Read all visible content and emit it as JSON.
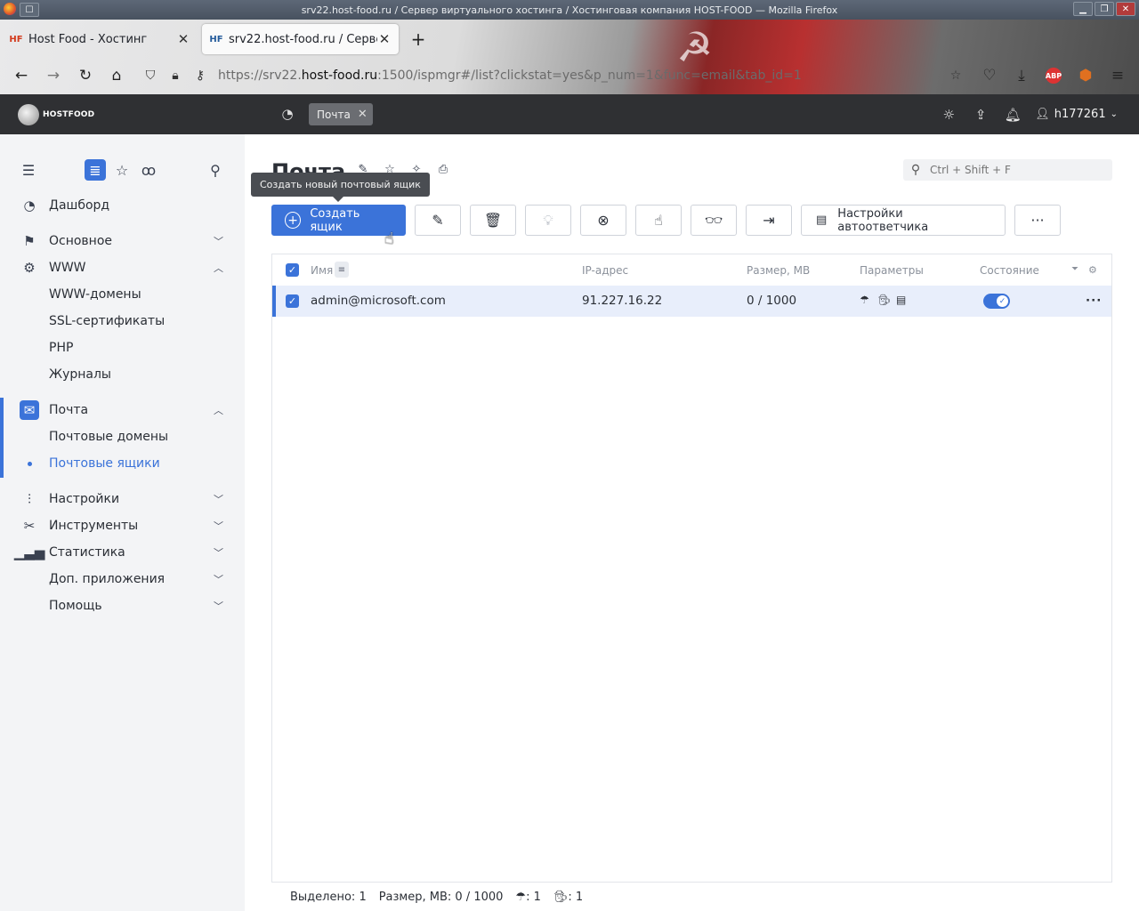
{
  "window": {
    "title": "srv22.host-food.ru / Сервер виртуального хостинга / Хостинговая компания HOST-FOOD — Mozilla Firefox"
  },
  "browser": {
    "tabs": [
      {
        "label": "Host Food - Хостинг",
        "favicon": "HF"
      },
      {
        "label": "srv22.host-food.ru / Сервер",
        "favicon": "HF"
      }
    ],
    "url_prefix": "https://srv22.",
    "url_host": "host-food.ru",
    "url_rest": ":1500/ispmgr#/list?clickstat=yes&p_num=1&func=email&tab_id=1",
    "extensions": [
      "pocket-icon",
      "download-icon",
      "adblock-icon",
      "shield-icon",
      "menu-icon"
    ],
    "abp_label": "ABP"
  },
  "app": {
    "logo_text": "HOSTFOOD",
    "active_chip": "Почта",
    "user": "h177261"
  },
  "sidebar": {
    "items": [
      {
        "label": "Дашборд",
        "icon": "dashboard-icon"
      },
      {
        "label": "Основное",
        "icon": "flag-icon"
      },
      {
        "label": "WWW",
        "icon": "www-icon"
      },
      {
        "label": "WWW-домены"
      },
      {
        "label": "SSL-сертификаты"
      },
      {
        "label": "PHP"
      },
      {
        "label": "Журналы"
      },
      {
        "label": "Почта",
        "icon": "mail-icon"
      },
      {
        "label": "Почтовые домены"
      },
      {
        "label": "Почтовые ящики"
      },
      {
        "label": "Настройки",
        "icon": "sliders-icon"
      },
      {
        "label": "Инструменты",
        "icon": "tools-icon"
      },
      {
        "label": "Статистика",
        "icon": "stats-icon"
      },
      {
        "label": "Доп. приложения"
      },
      {
        "label": "Помощь"
      }
    ]
  },
  "main": {
    "title": "Почта",
    "tooltip": "Создать новый почтовый ящик",
    "search_placeholder": "Ctrl + Shift + F",
    "create_label": "Создать ящик",
    "autoresponder_label": "Настройки автоответчика",
    "columns": [
      "Имя",
      "IP-адрес",
      "Размер, MB",
      "Параметры",
      "Состояние"
    ],
    "rows": [
      {
        "name": "admin@microsoft.com",
        "ip": "91.227.16.22",
        "size": "0 / 1000",
        "enabled": true
      }
    ],
    "footer": {
      "selected": "Выделено: 1",
      "size": "Размер, MB: 0 / 1000",
      "umbrella_count": ": 1",
      "spy_count": ": 1"
    }
  }
}
